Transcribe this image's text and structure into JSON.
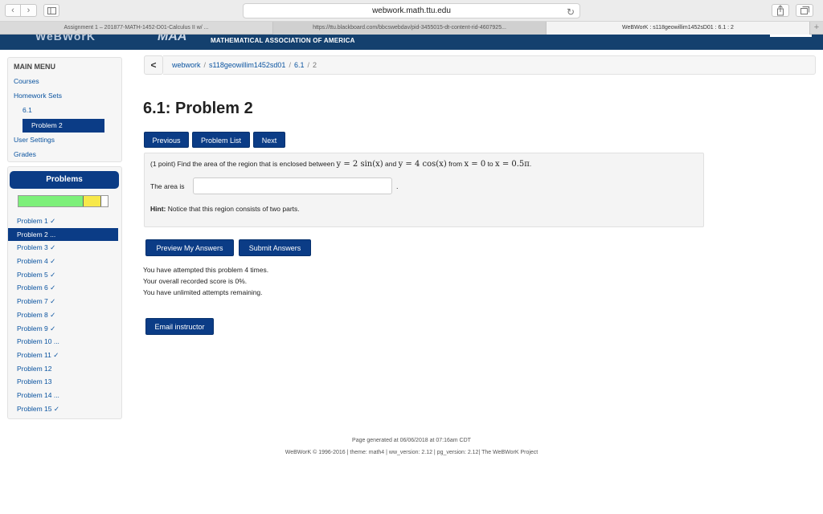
{
  "browser": {
    "address": "webwork.math.ttu.edu",
    "back_glyph": "‹",
    "forward_glyph": "›",
    "reload_glyph": "↻",
    "tabs": [
      {
        "label": "Assignment 1 – 201877-MATH-1452-D01-Calculus II w/ ..."
      },
      {
        "label": "https://ttu.blackboard.com/bbcswebdav/pid-3455015-dt-content-rid-4607925..."
      },
      {
        "label": "WeBWorK : s118geowillim1452sD01 : 6.1 : 2"
      }
    ],
    "add_tab": "+"
  },
  "header": {
    "logo": "WeBWorK",
    "maa_logo": "MAA",
    "maa_name": "MATHEMATICAL ASSOCIATION OF AMERICA",
    "brand_color": "#14406e"
  },
  "menu": {
    "title": "MAIN MENU",
    "courses": "Courses",
    "homework_sets": "Homework Sets",
    "set": "6.1",
    "current_problem": "Problem 2",
    "user_settings": "User Settings",
    "grades": "Grades"
  },
  "problems": {
    "header": "Problems",
    "progress_correct": 0.73,
    "progress_partial": 0.2,
    "items": [
      {
        "label": "Problem 1 ✓"
      },
      {
        "label": "Problem 2 ..."
      },
      {
        "label": "Problem 3 ✓"
      },
      {
        "label": "Problem 4 ✓"
      },
      {
        "label": "Problem 5 ✓"
      },
      {
        "label": "Problem 6 ✓"
      },
      {
        "label": "Problem 7 ✓"
      },
      {
        "label": "Problem 8 ✓"
      },
      {
        "label": "Problem 9 ✓"
      },
      {
        "label": "Problem 10 ..."
      },
      {
        "label": "Problem 11 ✓"
      },
      {
        "label": "Problem 12"
      },
      {
        "label": "Problem 13"
      },
      {
        "label": "Problem 14 ..."
      },
      {
        "label": "Problem 15 ✓"
      }
    ],
    "active_index": 1
  },
  "breadcrumb": {
    "back": "<",
    "root": "webwork",
    "course": "s118geowillim1452sd01",
    "set": "6.1",
    "problem": "2",
    "sep": "/"
  },
  "main": {
    "title": "6.1: Problem 2",
    "prev": "Previous",
    "problem_list": "Problem List",
    "next": "Next",
    "question_prefix": "(1 point) Find the area of the region that is enclosed between ",
    "eq1": "y = 2 sin(x)",
    "and1": " and ",
    "eq2": "y = 4 cos(x)",
    "from": " from ",
    "eq3": "x = 0",
    "to": " to ",
    "eq4": "x = 0.5π",
    "end": ".",
    "area_label": "The area is",
    "answer_value": "",
    "answer_period": ".",
    "hint_label": "Hint:",
    "hint_text": " Notice that this region consists of two parts.",
    "preview": "Preview My Answers",
    "submit": "Submit Answers",
    "status1": "You have attempted this problem 4 times.",
    "status2": "Your overall recorded score is 0%.",
    "status3": "You have unlimited attempts remaining.",
    "email": "Email instructor"
  },
  "footer": {
    "generated": "Page generated at 06/06/2018 at 07:16am CDT",
    "copyright": "WeBWorK © 1996-2016 | theme: math4 | ww_version: 2.12 | pg_version: 2.12| The WeBWorK Project"
  }
}
